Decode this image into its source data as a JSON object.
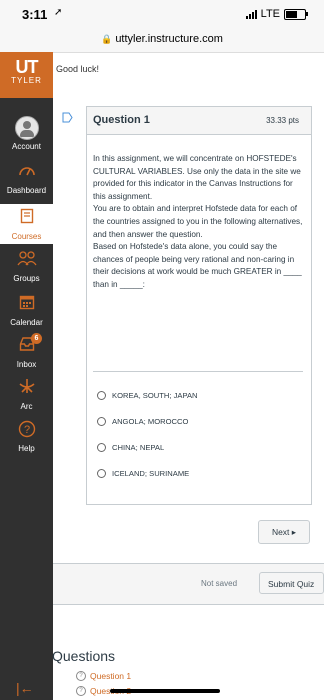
{
  "status": {
    "time": "3:11",
    "carrier": "LTE"
  },
  "browser": {
    "url": "uttyler.instructure.com"
  },
  "logo": {
    "mark": "UT",
    "sub": "TYLER"
  },
  "sidebar": {
    "items": [
      {
        "label": "Account",
        "icon": "account-avatar"
      },
      {
        "label": "Dashboard",
        "icon": "dashboard-icon"
      },
      {
        "label": "Courses",
        "icon": "courses-icon"
      },
      {
        "label": "Groups",
        "icon": "groups-icon"
      },
      {
        "label": "Calendar",
        "icon": "calendar-icon"
      },
      {
        "label": "Inbox",
        "icon": "inbox-icon",
        "badge": "6"
      },
      {
        "label": "Arc",
        "icon": "arc-icon"
      },
      {
        "label": "Help",
        "icon": "help-icon"
      }
    ]
  },
  "intro": "Good luck!",
  "question": {
    "title": "Question 1",
    "points": "33.33 pts",
    "paragraphs": [
      "In this assignment, we will concentrate on HOFSTEDE's CULTURAL VARIABLES. Use only the data in the site we provided for this indicator in the Canvas Instructions for this assignment.",
      "You are to obtain and interpret Hofstede data for each of the countries assigned to you in the following alternatives, and then answer the question.",
      "Based on Hofstede's data alone, you could say the chances of people being very rational and non-caring in their decisions at work would be much GREATER in ____ than in _____:"
    ],
    "answers": [
      "KOREA, SOUTH; JAPAN",
      "ANGOLA; MOROCCO",
      "CHINA; NEPAL",
      "ICELAND; SURINAME"
    ]
  },
  "buttons": {
    "next": "Next ▸",
    "submit": "Submit Quiz"
  },
  "save_status": "Not saved",
  "questions_panel": {
    "heading": "Questions",
    "items": [
      "Question 1",
      "Question 2"
    ]
  },
  "colors": {
    "brand": "#cf6b26",
    "sidebar": "#303030"
  }
}
